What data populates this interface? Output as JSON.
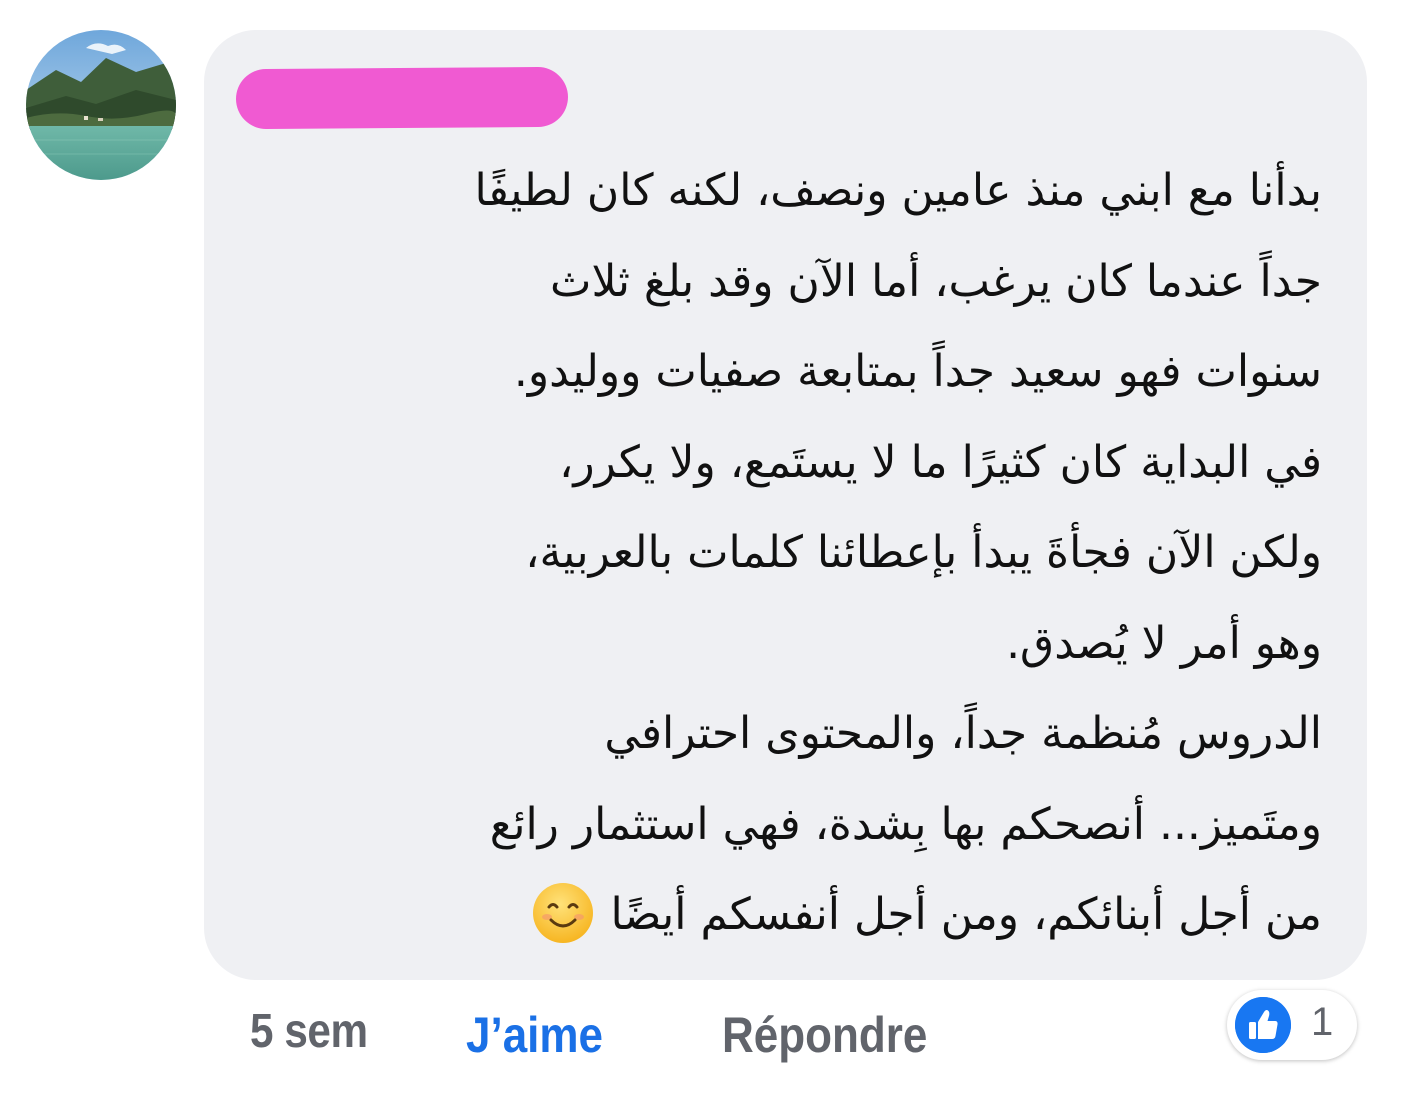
{
  "comment": {
    "avatar_icon": "landscape-avatar",
    "author_redacted_color": "#f05ad2",
    "lines": [
      "بدأنا مع ابني منذ عامين ونصف، لكنه كان لطيفًا",
      "جداً عندما كان يرغب، أما الآن وقد بلغ  ثلاث",
      "سنوات  فهو سعيد جداً بمتابعة صفيات ووليدو.",
      "في البداية كان كثيرًا ما لا يستَمع، ولا يكرر،",
      "ولكن الآن فجأةَ يبدأ بإعطائنا كلمات بالعربية،",
      "وهو أمر لا يُصدق.",
      "الدروس مُنظمة جداً، والمحتوى احترافي",
      "ومتَميز... أنصحكم بها بِشدة، فهي استثمار رائع",
      "من أجل أبنائكم، ومن أجل أنفسكم أيضًا"
    ],
    "emoji_icon": "smiling-face-emoji",
    "bubble_color": "#eff0f3"
  },
  "actions": {
    "timestamp": "5 sem",
    "like_label": "J’aime",
    "reply_label": "Répondre",
    "like_color": "#1a70e6"
  },
  "reactions": {
    "icon": "thumbs-up-icon",
    "count": "1"
  }
}
